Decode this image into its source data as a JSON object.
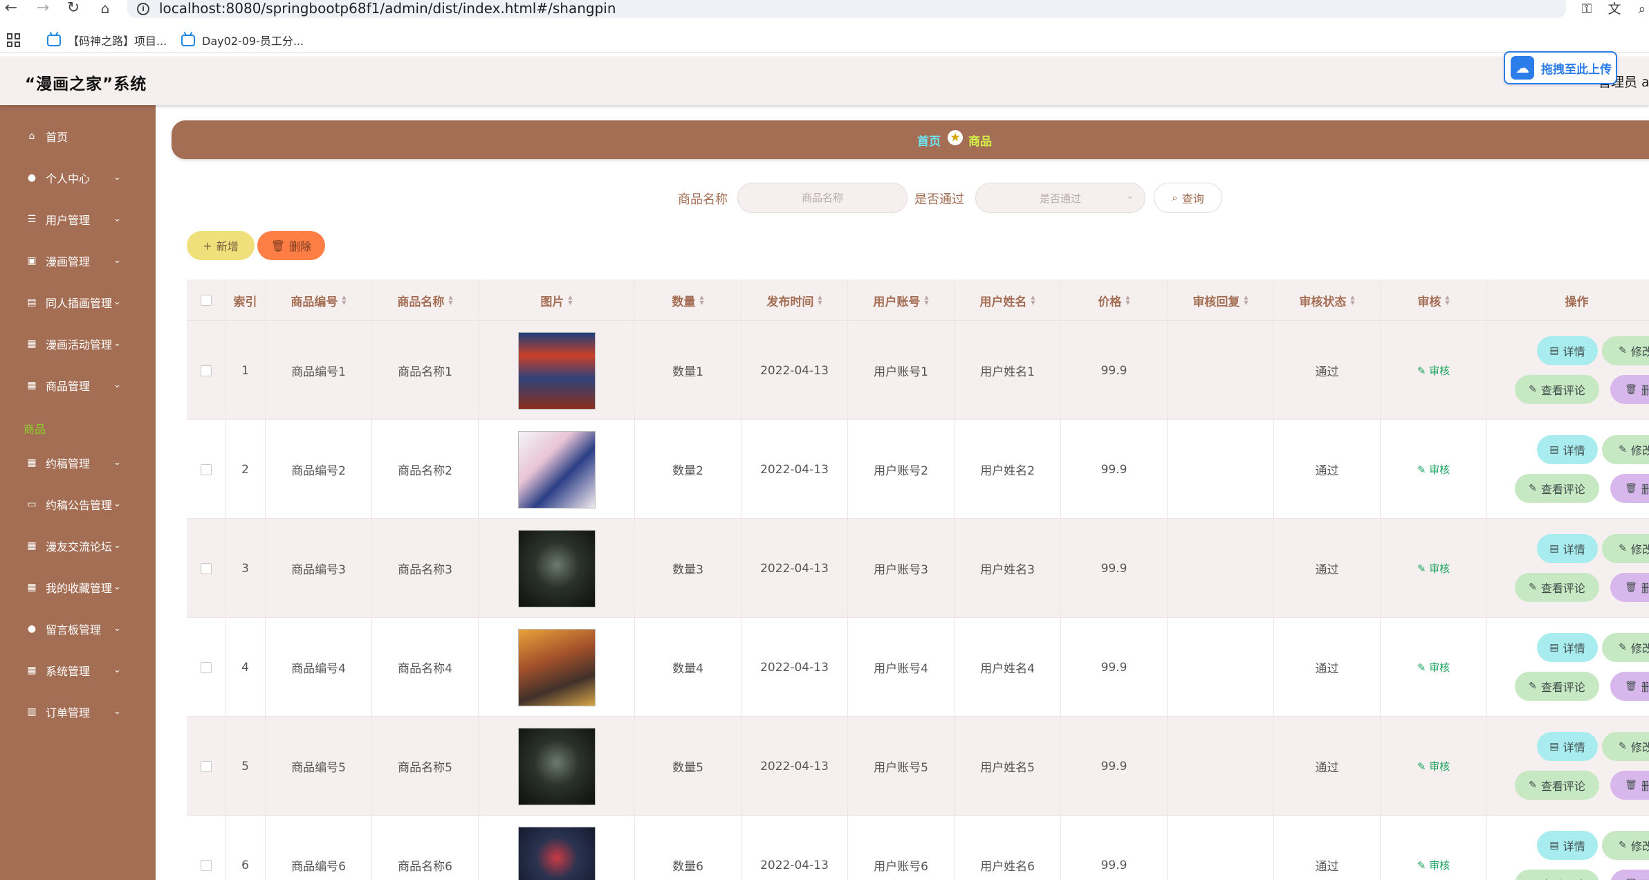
{
  "browser": {
    "url": "localhost:8080/springbootp68f1/admin/dist/index.html#/shangpin",
    "bookmarks": [
      "【码神之路】项目...",
      "Day02-09-员工分..."
    ]
  },
  "header": {
    "title": "“漫画之家”系统",
    "user": "管理员 ab",
    "upload_label": "拖拽至此上传"
  },
  "sidebar": {
    "items": [
      {
        "label": "首页",
        "icon": "home-icon",
        "has_children": false
      },
      {
        "label": "个人中心",
        "icon": "user-icon",
        "has_children": true
      },
      {
        "label": "用户管理",
        "icon": "menu-icon",
        "has_children": true
      },
      {
        "label": "漫画管理",
        "icon": "book-icon",
        "has_children": true
      },
      {
        "label": "同人插画管理",
        "icon": "doc-icon",
        "has_children": true
      },
      {
        "label": "漫画活动管理",
        "icon": "grid-icon",
        "has_children": true
      },
      {
        "label": "商品管理",
        "icon": "grid-icon",
        "has_children": true
      },
      {
        "label": "约稿管理",
        "icon": "grid-icon",
        "has_children": true
      },
      {
        "label": "约稿公告管理",
        "icon": "monitor-icon",
        "has_children": true
      },
      {
        "label": "漫友交流论坛",
        "icon": "grid-icon",
        "has_children": true
      },
      {
        "label": "我的收藏管理",
        "icon": "grid-icon",
        "has_children": true
      },
      {
        "label": "留言板管理",
        "icon": "user-icon",
        "has_children": true
      },
      {
        "label": "系统管理",
        "icon": "grid-icon",
        "has_children": true
      },
      {
        "label": "订单管理",
        "icon": "chart-icon",
        "has_children": true
      }
    ],
    "active_sub": "商品"
  },
  "breadcrumb": {
    "home": "首页",
    "current": "商品"
  },
  "search": {
    "name_label": "商品名称",
    "name_placeholder": "商品名称",
    "status_label": "是否通过",
    "status_placeholder": "是否通过",
    "query_label": "查询"
  },
  "actions": {
    "add_label": "新增",
    "delete_label": "删除"
  },
  "table": {
    "headers": [
      "索引",
      "商品编号",
      "商品名称",
      "图片",
      "数量",
      "发布时间",
      "用户账号",
      "用户姓名",
      "价格",
      "审核回复",
      "审核状态",
      "审核",
      "操作"
    ],
    "rows": [
      {
        "index": "1",
        "code": "商品编号1",
        "name": "商品名称1",
        "qty": "数量1",
        "date": "2022-04-13",
        "account": "用户账号1",
        "username": "用户姓名1",
        "price": "99.9",
        "reply": "",
        "status": "通过",
        "audit": "审核",
        "cover": "cover-blue"
      },
      {
        "index": "2",
        "code": "商品编号2",
        "name": "商品名称2",
        "qty": "数量2",
        "date": "2022-04-13",
        "account": "用户账号2",
        "username": "用户姓名2",
        "price": "99.9",
        "reply": "",
        "status": "通过",
        "audit": "审核",
        "cover": "cover-light"
      },
      {
        "index": "3",
        "code": "商品编号3",
        "name": "商品名称3",
        "qty": "数量3",
        "date": "2022-04-13",
        "account": "用户账号3",
        "username": "用户姓名3",
        "price": "99.9",
        "reply": "",
        "status": "通过",
        "audit": "审核",
        "cover": "cover-dark"
      },
      {
        "index": "4",
        "code": "商品编号4",
        "name": "商品名称4",
        "qty": "数量4",
        "date": "2022-04-13",
        "account": "用户账号4",
        "username": "用户姓名4",
        "price": "99.9",
        "reply": "",
        "status": "通过",
        "audit": "审核",
        "cover": "cover-orange"
      },
      {
        "index": "5",
        "code": "商品编号5",
        "name": "商品名称5",
        "qty": "数量5",
        "date": "2022-04-13",
        "account": "用户账号5",
        "username": "用户姓名5",
        "price": "99.9",
        "reply": "",
        "status": "通过",
        "audit": "审核",
        "cover": "cover-dark"
      },
      {
        "index": "6",
        "code": "商品编号6",
        "name": "商品名称6",
        "qty": "数量6",
        "date": "2022-04-13",
        "account": "用户账号6",
        "username": "用户姓名6",
        "price": "99.9",
        "reply": "",
        "status": "通过",
        "audit": "审核",
        "cover": "cover-navy"
      }
    ],
    "row_actions": {
      "detail": "详情",
      "edit": "修改",
      "review": "查看评论",
      "delete": "删除"
    }
  },
  "colors": {
    "sidebar": "#a46e54",
    "header": "#f6efef",
    "accent_add": "#f0e07c",
    "accent_delete": "#ff7e45"
  }
}
